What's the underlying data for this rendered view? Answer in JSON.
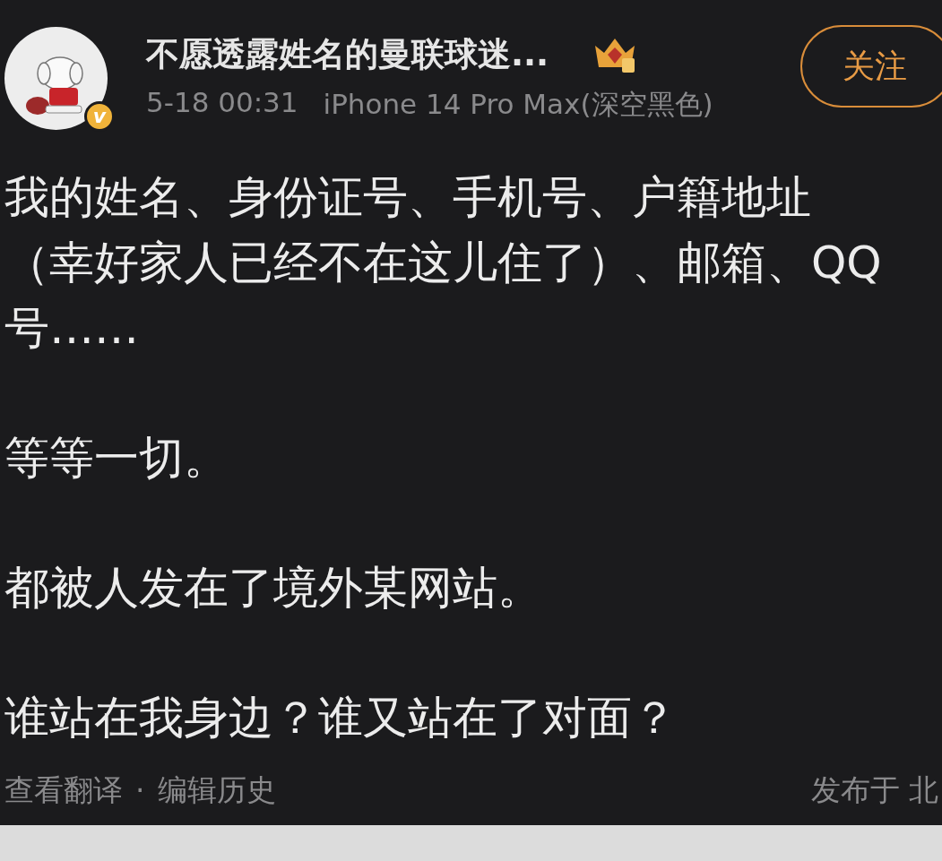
{
  "post": {
    "author": {
      "name": "不愿透露姓名的曼联球迷...",
      "verified_badge": "v"
    },
    "follow_button": "关注",
    "time": "5-18 00:31",
    "device": "iPhone 14 Pro Max(深空黑色)",
    "paragraphs": [
      [
        "我的姓名、身份证号、手机号、户籍地址",
        "（幸好家人已经不在这儿住了）、邮箱、QQ",
        "号……"
      ],
      [
        "等等一切。"
      ],
      [
        "都被人发在了境外某网站。"
      ],
      [
        "谁站在我身边？谁又站在了对面？"
      ]
    ],
    "footer": {
      "links": [
        "查看翻译",
        "编辑历史"
      ],
      "separator": "·",
      "location": "发布于 北"
    }
  }
}
